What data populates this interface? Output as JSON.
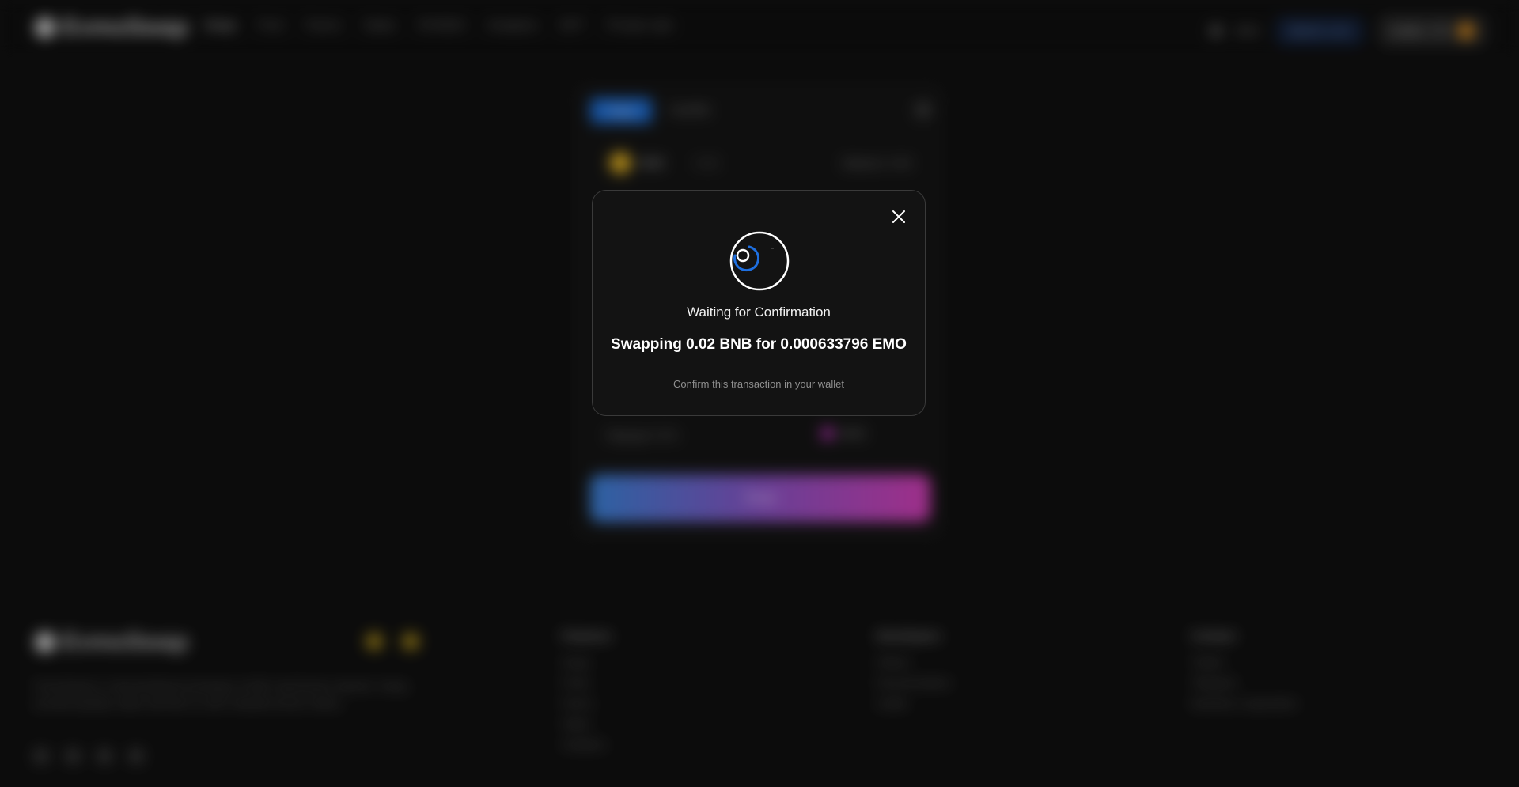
{
  "header": {
    "brand": "EvmoSwap",
    "nav": [
      "Swap",
      "Pool",
      "Farms",
      "Stake",
      "IFO/IDO",
      "Analytics",
      "NFT",
      "Private sale"
    ],
    "network": "BSC",
    "pill": "$EMO 0.00",
    "account": "0x8b6...f74"
  },
  "swap_card": {
    "tabs": [
      "Swap",
      "Liquidity"
    ],
    "from_token": "BNB",
    "from_amount": "0.02",
    "balance": "Balance: 0.00",
    "rate_label": "Slippage 0.5%",
    "to_token": "EMO",
    "swap_button": "Swap"
  },
  "footer": {
    "brand": "EvmoSwap",
    "description": "EvmoSwap is a decentralized exchange on BSC and Evmos network. Swap, provide liquidity, stake and farm to earn rewards across chains.",
    "col1_title": "Features",
    "col1_items": [
      "Swap",
      "Pools",
      "Farms",
      "Stake",
      "Analytics"
    ],
    "col2_title": "Developers",
    "col2_items": [
      "Github",
      "Documentation",
      "Audits"
    ],
    "col3_title": "Contact",
    "col3_items": [
      "Twitter",
      "Telegram",
      "Business cooperation"
    ]
  },
  "modal": {
    "title": "Waiting for Confirmation",
    "detail": "Swapping 0.02 BNB for 0.000633796 EMO",
    "hint": "Confirm this transaction in your wallet",
    "spinner_color": "#1e6fe0"
  }
}
